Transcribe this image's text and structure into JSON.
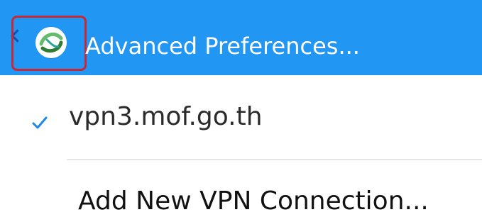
{
  "header": {
    "title": "Advanced Preferences...",
    "logo_icon": "anyconnect-logo-icon",
    "back_icon": "chevron-left-icon",
    "bg_color": "#2196f3"
  },
  "connections": [
    {
      "label": "vpn3.mof.go.th",
      "selected": true,
      "icon": "check-icon"
    }
  ],
  "actions": {
    "add_connection_label": "Add New VPN Connection..."
  },
  "accent_color": "#1e88e5"
}
